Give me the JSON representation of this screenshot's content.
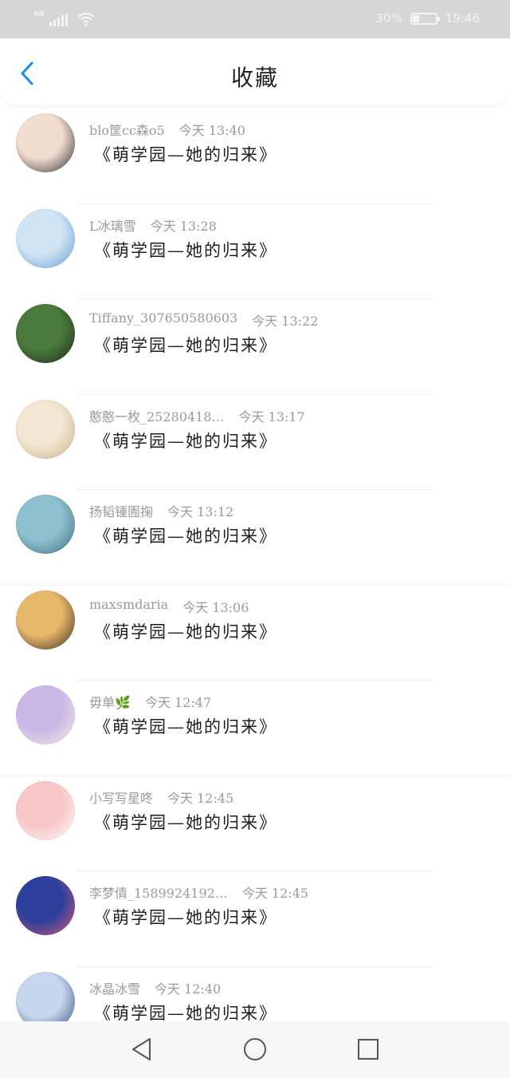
{
  "status_bar": {
    "network": "4G",
    "battery": "30%",
    "battery_level": 0.3,
    "time": "19:46"
  },
  "header": {
    "back_icon": "chevron-left-icon",
    "title": "收藏",
    "accent_color": "#1a8fe8"
  },
  "items": [
    {
      "user": "blo筐cc森o5",
      "time": "今天  13:40",
      "title": "《萌学园—她的归来》",
      "avatar_colors": [
        "#f2dccf",
        "#2a2a2a"
      ]
    },
    {
      "user": "L冰璃雪",
      "time": "今天  13:28",
      "title": "《萌学园—她的归来》",
      "avatar_colors": [
        "#cfe4f4",
        "#6b9fd0"
      ]
    },
    {
      "user": "Tiffany_307650580603",
      "time": "今天  13:22",
      "title": "《萌学园—她的归来》",
      "avatar_colors": [
        "#4a7a3c",
        "#1f2a1a"
      ]
    },
    {
      "user": "憨憨一枚_25280418…",
      "time": "今天  13:17",
      "title": "《萌学园—她的归来》",
      "avatar_colors": [
        "#f3e6d2",
        "#c9b28c"
      ]
    },
    {
      "user": "扬韬锺圊掬",
      "time": "今天  13:12",
      "title": "《萌学园—她的归来》",
      "avatar_colors": [
        "#8fc0cf",
        "#3b6f82"
      ]
    },
    {
      "user": "maxsmdaria",
      "time": "今天  13:06",
      "title": "《萌学园—她的归来》",
      "avatar_colors": [
        "#e7b76a",
        "#3a2a22"
      ]
    },
    {
      "user": "毋单🌿",
      "time": "今天  12:47",
      "title": "《萌学园—她的归来》",
      "avatar_colors": [
        "#c9b7e5",
        "#f4eee6"
      ]
    },
    {
      "user": "小写写星咚",
      "time": "今天  12:45",
      "title": "《萌学园—她的归来》",
      "avatar_colors": [
        "#f7c6c6",
        "#ffffff"
      ]
    },
    {
      "user": "李梦倩_1589924192…",
      "time": "今天  12:45",
      "title": "《萌学园—她的归来》",
      "avatar_colors": [
        "#2d3f9a",
        "#d45a7c"
      ]
    },
    {
      "user": "冰晶冰雪",
      "time": "今天  12:40",
      "title": "《萌学园—她的归来》",
      "avatar_colors": [
        "#c7d6ec",
        "#3a4f86"
      ]
    }
  ],
  "nav": {
    "back_icon": "triangle-back-icon",
    "home_icon": "circle-home-icon",
    "recents_icon": "square-recents-icon"
  }
}
